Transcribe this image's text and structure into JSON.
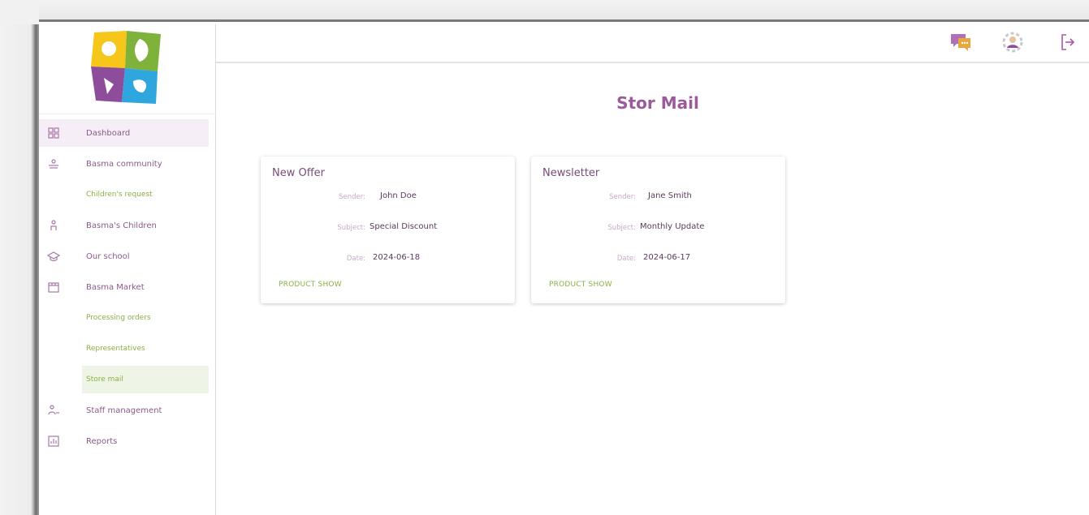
{
  "sidebar": {
    "items": [
      {
        "label": "Dashboard",
        "icon": "grid-icon",
        "type": "main",
        "active": true
      },
      {
        "label": "Basma community",
        "icon": "community-icon",
        "type": "main"
      },
      {
        "label": "Children's request",
        "type": "sub"
      },
      {
        "label": "Basma's Children",
        "icon": "child-icon",
        "type": "main"
      },
      {
        "label": "Our school",
        "icon": "school-icon",
        "type": "main"
      },
      {
        "label": "Basma Market",
        "icon": "market-icon",
        "type": "main"
      },
      {
        "label": "Processing orders",
        "type": "sub"
      },
      {
        "label": "Representatives",
        "type": "sub"
      },
      {
        "label": "Store mail",
        "type": "sub",
        "active": true
      },
      {
        "label": "Staff management",
        "icon": "staff-icon",
        "type": "main"
      },
      {
        "label": "Reports",
        "icon": "reports-icon",
        "type": "main"
      }
    ]
  },
  "topbar": {
    "icons": [
      "chat-icon",
      "user-settings-icon",
      "logout-icon"
    ]
  },
  "main": {
    "title": "Stor Mail",
    "mails": [
      {
        "title": "New Offer",
        "sender_label": "Sender:",
        "sender": "John Doe",
        "subject_label": "Subject:",
        "subject": "Special Discount",
        "date_label": "Date:",
        "date": "2024-06-18",
        "action": "PRODUCT SHOW"
      },
      {
        "title": "Newsletter",
        "sender_label": "Sender:",
        "sender": "Jane Smith",
        "subject_label": "Subject:",
        "subject": "Monthly Update",
        "date_label": "Date:",
        "date": "2024-06-17",
        "action": "PRODUCT SHOW"
      }
    ]
  },
  "colors": {
    "brand_purple": "#9b5b9b",
    "accent_green": "#8bb043",
    "active_bg": "#f6eef6"
  }
}
